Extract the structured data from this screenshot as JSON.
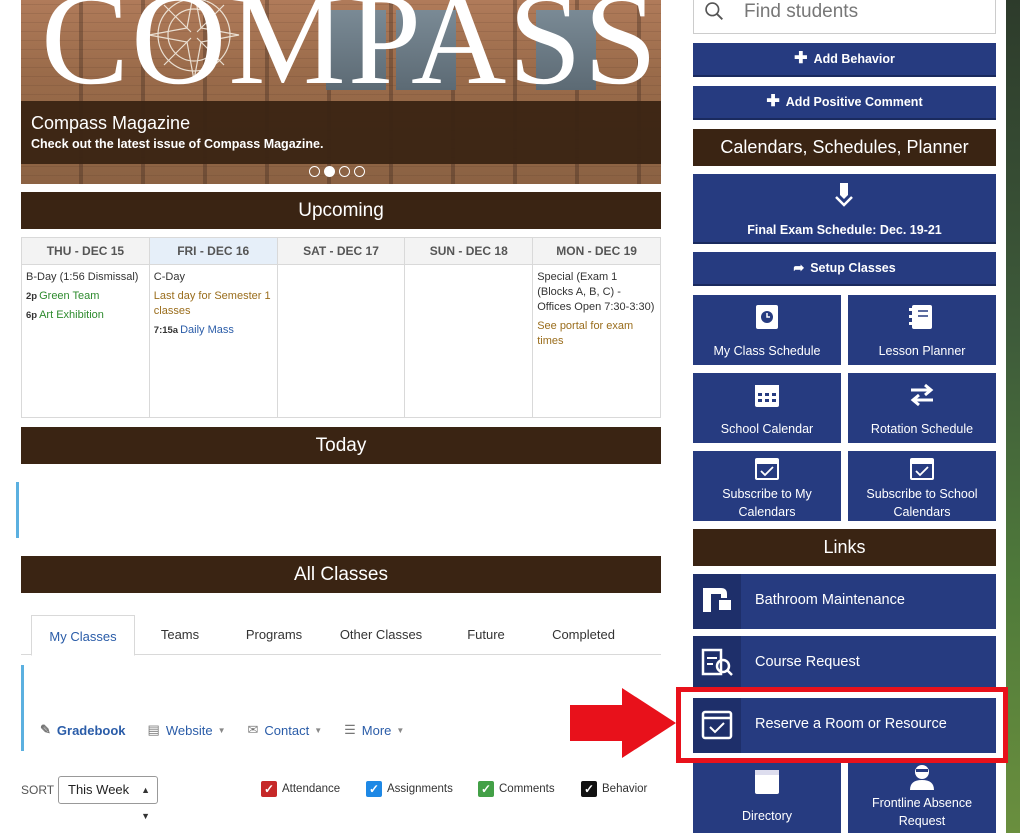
{
  "banner": {
    "word": "COMPASS",
    "title": "Compass Magazine",
    "subtitle": "Check out the latest issue of Compass Magazine."
  },
  "upcoming": {
    "title": "Upcoming",
    "days": [
      {
        "label": "THU - DEC 15",
        "events": [
          {
            "time": "",
            "text": "B-Day (1:56 Dismissal)",
            "color": "#333333"
          },
          {
            "time": "2p",
            "text": "Green Team",
            "color": "#2e8b2e"
          },
          {
            "time": "6p",
            "text": "Art Exhibition",
            "color": "#2e8b2e"
          }
        ]
      },
      {
        "label": "FRI - DEC 16",
        "events": [
          {
            "time": "",
            "text": "C-Day",
            "color": "#333333"
          },
          {
            "time": "",
            "text": "Last day for Semester 1 classes",
            "color": "#9a6d1c"
          },
          {
            "time": "7:15a",
            "text": "Daily Mass",
            "color": "#2a5ca8"
          }
        ]
      },
      {
        "label": "SAT - DEC 17",
        "events": []
      },
      {
        "label": "SUN - DEC 18",
        "events": []
      },
      {
        "label": "MON - DEC 19",
        "events": [
          {
            "time": "",
            "text": "Special (Exam 1 (Blocks A, B, C) - Offices Open 7:30-3:30)",
            "color": "#333333"
          },
          {
            "time": "",
            "text": "See portal for exam times",
            "color": "#9a6d1c"
          }
        ]
      }
    ]
  },
  "today": {
    "title": "Today"
  },
  "all_classes": {
    "title": "All Classes",
    "tabs": [
      "My Classes",
      "Teams",
      "Programs",
      "Other Classes",
      "Future",
      "Completed"
    ],
    "links": {
      "gradebook": "Gradebook",
      "website": "Website",
      "contact": "Contact",
      "more": "More"
    },
    "sort_label": "SORT",
    "sort_value": "This Week",
    "filters": {
      "attendance": "Attendance",
      "assignments": "Assignments",
      "comments": "Comments",
      "behavior": "Behavior"
    }
  },
  "sidebar": {
    "search_placeholder": "Find students",
    "add_behavior": "Add Behavior",
    "add_positive_comment": "Add Positive Comment",
    "calendars_title": "Calendars, Schedules, Planner",
    "final_exam": "Final Exam Schedule: Dec. 19-21",
    "setup_classes": "Setup Classes",
    "tiles": {
      "my_class_schedule": "My Class Schedule",
      "lesson_planner": "Lesson Planner",
      "school_calendar": "School Calendar",
      "rotation_schedule": "Rotation Schedule",
      "subscribe_my": "Subscribe to My Calendars",
      "subscribe_school": "Subscribe to School Calendars",
      "directory": "Directory",
      "frontline": "Frontline Absence Request"
    },
    "links_title": "Links",
    "links": {
      "bathroom": "Bathroom Maintenance",
      "course_request": "Course Request",
      "reserve": "Reserve a Room or Resource"
    }
  },
  "colors": {
    "brown": "#3a2413",
    "navy": "#263b80",
    "highlight": "#e8111b"
  }
}
